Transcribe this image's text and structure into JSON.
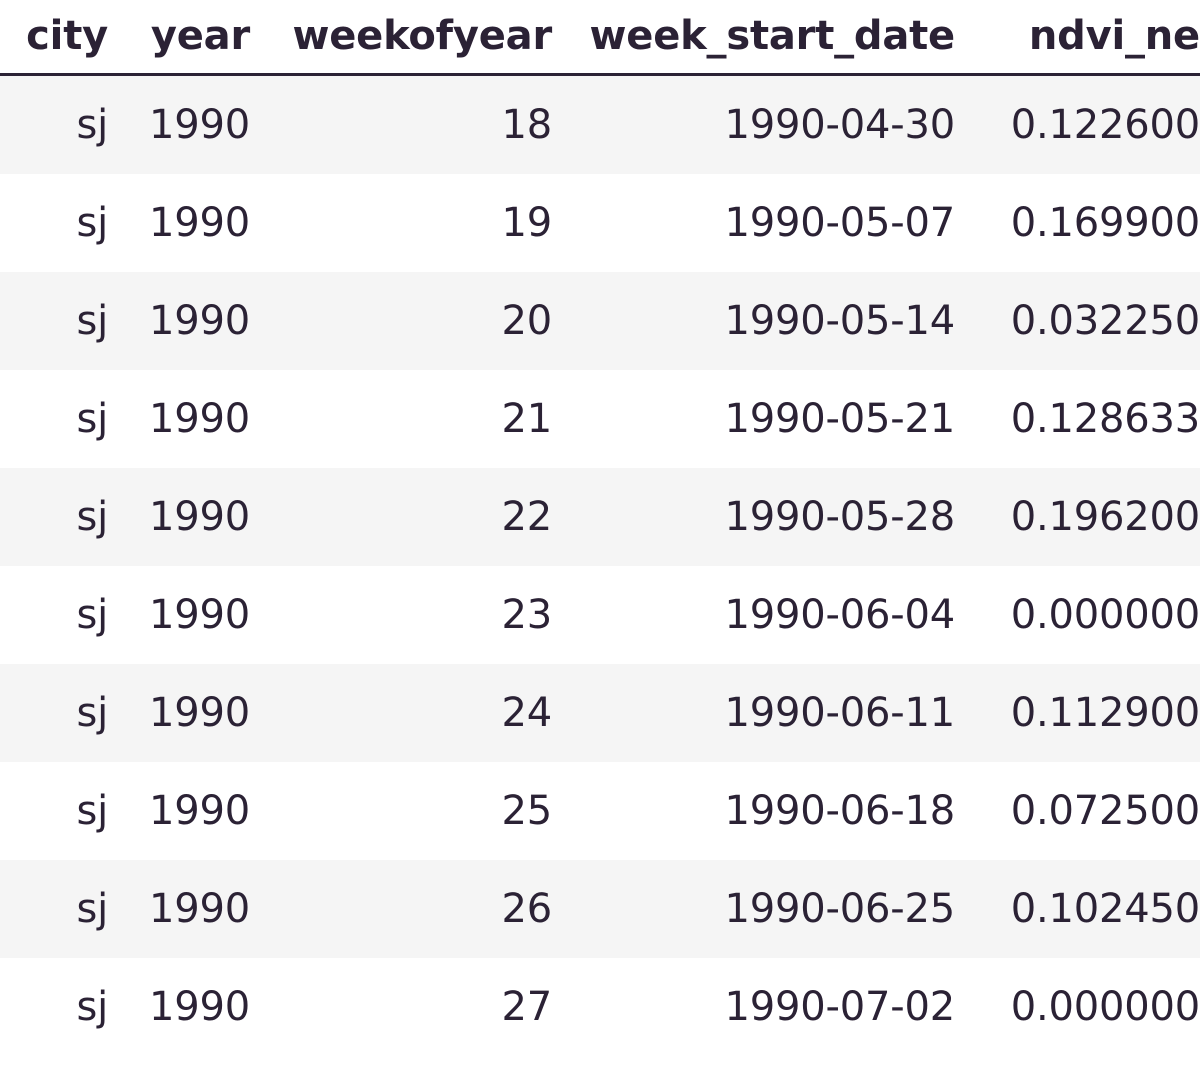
{
  "table": {
    "columns": [
      {
        "key": "city",
        "label": "city",
        "align": "right"
      },
      {
        "key": "year",
        "label": "year",
        "align": "right"
      },
      {
        "key": "weekofyear",
        "label": "weekofyear",
        "align": "right"
      },
      {
        "key": "week_start_date",
        "label": "week_start_date",
        "align": "right"
      },
      {
        "key": "ndvi_ne",
        "label": "ndvi_ne",
        "align": "right"
      }
    ],
    "rows": [
      {
        "city": "sj",
        "year": "1990",
        "weekofyear": "18",
        "week_start_date": "1990-04-30",
        "ndvi_ne": "0.122600"
      },
      {
        "city": "sj",
        "year": "1990",
        "weekofyear": "19",
        "week_start_date": "1990-05-07",
        "ndvi_ne": "0.169900"
      },
      {
        "city": "sj",
        "year": "1990",
        "weekofyear": "20",
        "week_start_date": "1990-05-14",
        "ndvi_ne": "0.032250"
      },
      {
        "city": "sj",
        "year": "1990",
        "weekofyear": "21",
        "week_start_date": "1990-05-21",
        "ndvi_ne": "0.128633"
      },
      {
        "city": "sj",
        "year": "1990",
        "weekofyear": "22",
        "week_start_date": "1990-05-28",
        "ndvi_ne": "0.196200"
      },
      {
        "city": "sj",
        "year": "1990",
        "weekofyear": "23",
        "week_start_date": "1990-06-04",
        "ndvi_ne": "0.000000"
      },
      {
        "city": "sj",
        "year": "1990",
        "weekofyear": "24",
        "week_start_date": "1990-06-11",
        "ndvi_ne": "0.112900"
      },
      {
        "city": "sj",
        "year": "1990",
        "weekofyear": "25",
        "week_start_date": "1990-06-18",
        "ndvi_ne": "0.072500"
      },
      {
        "city": "sj",
        "year": "1990",
        "weekofyear": "26",
        "week_start_date": "1990-06-25",
        "ndvi_ne": "0.102450"
      },
      {
        "city": "sj",
        "year": "1990",
        "weekofyear": "27",
        "week_start_date": "1990-07-02",
        "ndvi_ne": "0.000000"
      }
    ]
  },
  "colors": {
    "text": "#2b2235",
    "header_rule": "#2b2235",
    "row_alt_background": "#f5f5f5",
    "row_background": "#ffffff",
    "page_background": "#ffffff"
  }
}
